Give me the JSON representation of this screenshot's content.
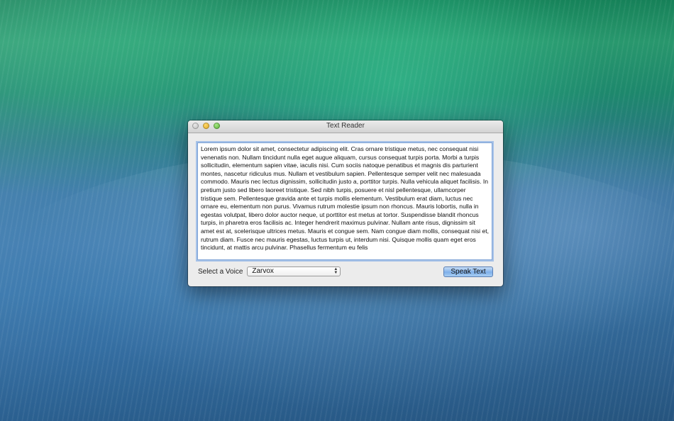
{
  "window": {
    "title": "Text Reader"
  },
  "text_area": {
    "value": "Lorem ipsum dolor sit amet, consectetur adipiscing elit. Cras ornare tristique metus, nec consequat nisi venenatis non. Nullam tincidunt nulla eget augue aliquam, cursus consequat turpis porta. Morbi a turpis sollicitudin, elementum sapien vitae, iaculis nisi. Cum sociis natoque penatibus et magnis dis parturient montes, nascetur ridiculus mus. Nullam et vestibulum sapien. Pellentesque semper velit nec malesuada commodo. Mauris nec lectus dignissim, sollicitudin justo a, porttitor turpis. Nulla vehicula aliquet facilisis. In pretium justo sed libero laoreet tristique. Sed nibh turpis, posuere et nisl pellentesque, ullamcorper tristique sem. Pellentesque gravida ante et turpis mollis elementum. Vestibulum erat diam, luctus nec ornare eu, elementum non purus. Vivamus rutrum molestie ipsum non rhoncus. Mauris lobortis, nulla in egestas volutpat, libero dolor auctor neque, ut porttitor est metus at tortor. Suspendisse blandit rhoncus turpis, in pharetra eros facilisis ac. Integer hendrerit maximus pulvinar. Nullam ante risus, dignissim sit amet est at, scelerisque ultrices metus. Mauris et congue sem. Nam congue diam mollis, consequat nisi et, rutrum diam. Fusce nec mauris egestas, luctus turpis ut, interdum nisi. Quisque mollis quam eget eros tincidunt, at mattis arcu pulvinar. Phasellus fermentum eu felis"
  },
  "voice": {
    "label": "Select a Voice",
    "selected": "Zarvox"
  },
  "speak_button": {
    "label": "Speak Text"
  }
}
